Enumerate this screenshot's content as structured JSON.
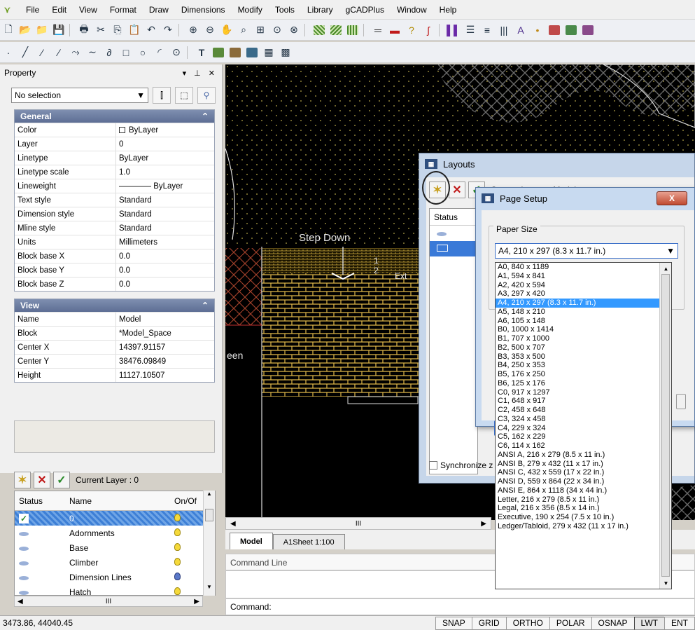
{
  "menu": [
    "File",
    "Edit",
    "View",
    "Format",
    "Draw",
    "Dimensions",
    "Modify",
    "Tools",
    "Library",
    "gCADPlus",
    "Window",
    "Help"
  ],
  "property": {
    "title": "Property",
    "selection": "No selection",
    "general": {
      "title": "General",
      "rows": [
        [
          "Color",
          "ByLayer"
        ],
        [
          "Layer",
          "0"
        ],
        [
          "Linetype",
          "ByLayer"
        ],
        [
          "Linetype scale",
          "1.0"
        ],
        [
          "Lineweight",
          "———— ByLayer"
        ],
        [
          "Text style",
          "Standard"
        ],
        [
          "Dimension style",
          "Standard"
        ],
        [
          "Mline style",
          "Standard"
        ],
        [
          "Units",
          "Millimeters"
        ],
        [
          "Block base X",
          "0.0"
        ],
        [
          "Block base Y",
          "0.0"
        ],
        [
          "Block base Z",
          "0.0"
        ]
      ]
    },
    "view": {
      "title": "View",
      "rows": [
        [
          "Name",
          "Model"
        ],
        [
          "Block",
          "*Model_Space"
        ],
        [
          "Center X",
          "14397.91157"
        ],
        [
          "Center Y",
          "38476.09849"
        ],
        [
          "Height",
          "11127.10507"
        ]
      ]
    }
  },
  "layers": {
    "current": "Current Layer : 0",
    "columns": [
      "Status",
      "Name",
      "On/Of"
    ],
    "rows": [
      {
        "name": "0",
        "selected": true
      },
      {
        "name": "Adornments",
        "selected": false
      },
      {
        "name": "Base",
        "selected": false
      },
      {
        "name": "Climber",
        "selected": false
      },
      {
        "name": "Dimension Lines",
        "selected": false
      },
      {
        "name": "Hatch",
        "selected": false
      }
    ]
  },
  "canvas": {
    "labels": {
      "step_down": "Step Down",
      "een": "een",
      "num1": "1",
      "num2": "2",
      "ext": "Ext"
    },
    "hscroll_mid": "III"
  },
  "tabs": [
    "Model",
    "A1Sheet 1:100"
  ],
  "command": {
    "title": "Command Line",
    "prompt": "Command:"
  },
  "status": {
    "coords": "3473.86, 44040.45",
    "buttons": [
      "SNAP",
      "GRID",
      "ORTHO",
      "POLAR",
      "OSNAP",
      "LWT",
      "ENT"
    ]
  },
  "layouts_dialog": {
    "title": "Layouts",
    "current_layout": "Current Layout : Model",
    "status_col": "Status",
    "sync": "Synchronize z"
  },
  "page_setup": {
    "title": "Page Setup",
    "close": "X",
    "group_label": "Paper Size",
    "selected": "A4,  210 x 297 (8.3 x 11.7 in.)",
    "options": [
      "A0,  840 x 1189",
      "A1,  594 x 841",
      "A2,  420 x 594",
      "A3,  297 x 420",
      "A4,  210 x 297 (8.3 x 11.7 in.)",
      "A5,  148 x 210",
      "A6,  105 x 148",
      "B0,  1000 x 1414",
      "B1,  707 x 1000",
      "B2,  500 x 707",
      "B3,  353 x 500",
      "B4,  250 x 353",
      "B5,  176 x 250",
      "B6,  125 x 176",
      "C0,  917 x 1297",
      "C1,  648 x 917",
      "C2,  458 x 648",
      "C3,  324 x 458",
      "C4,  229 x 324",
      "C5,  162 x 229",
      "C6,  114 x 162",
      "ANSI A,  216 x 279 (8.5 x 11 in.)",
      "ANSI B,  279 x 432 (11 x 17 in.)",
      "ANSI C,  432 x 559 (17 x 22 in.)",
      "ANSI D,  559 x 864 (22 x 34 in.)",
      "ANSI E,  864 x 1118 (34 x 44 in.)",
      "Letter,  216 x 279 (8.5 x 11 in.)",
      "Legal,  216 x 356 (8.5 x 14 in.)",
      "Executive,  190 x 254 (7.5 x 10 in.)",
      "Ledger/Tabloid,  279 x 432 (11 x 17 in.)"
    ]
  }
}
